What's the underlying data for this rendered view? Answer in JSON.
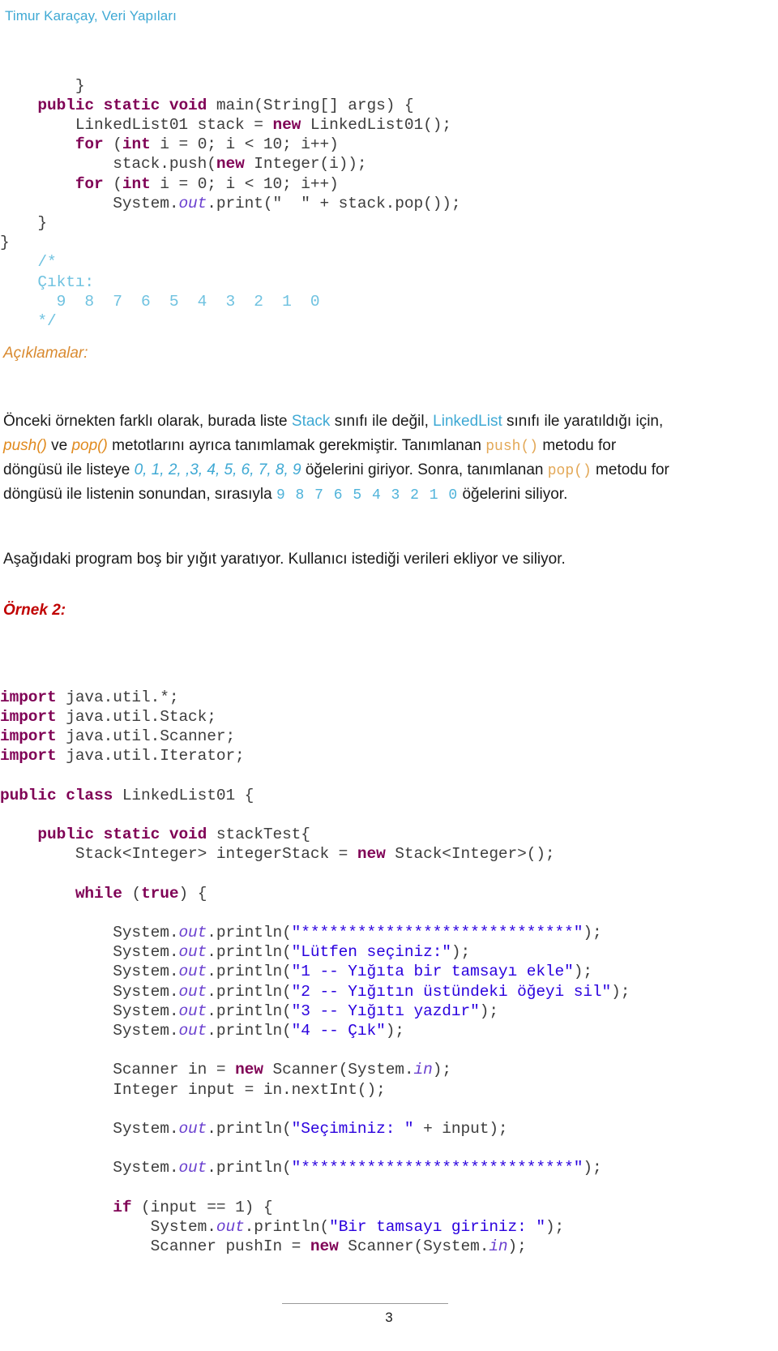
{
  "header": {
    "running_title": "Timur Karaçay, Veri Yapıları",
    "color": "#3FA9D4"
  },
  "code_block_1": {
    "lines": [
      [
        {
          "t": "        }",
          "c": "plain"
        }
      ],
      [
        {
          "t": "    ",
          "c": "plain"
        },
        {
          "t": "public static void ",
          "c": "kw"
        },
        {
          "t": "main(String[] args) {",
          "c": "plain"
        }
      ],
      [
        {
          "t": "        LinkedList01 stack = ",
          "c": "plain"
        },
        {
          "t": "new ",
          "c": "kw"
        },
        {
          "t": "LinkedList01();",
          "c": "plain"
        }
      ],
      [
        {
          "t": "        ",
          "c": "plain"
        },
        {
          "t": "for ",
          "c": "kw"
        },
        {
          "t": "(",
          "c": "plain"
        },
        {
          "t": "int ",
          "c": "kw"
        },
        {
          "t": "i = 0; i < 10; i++)",
          "c": "plain"
        }
      ],
      [
        {
          "t": "            stack.push(",
          "c": "plain"
        },
        {
          "t": "new ",
          "c": "kw"
        },
        {
          "t": "Integer(i));",
          "c": "plain"
        }
      ],
      [
        {
          "t": "        ",
          "c": "plain"
        },
        {
          "t": "for ",
          "c": "kw"
        },
        {
          "t": "(",
          "c": "plain"
        },
        {
          "t": "int ",
          "c": "kw"
        },
        {
          "t": "i = 0; i < 10; i++)",
          "c": "plain"
        }
      ],
      [
        {
          "t": "            System.",
          "c": "plain"
        },
        {
          "t": "out",
          "c": "fld"
        },
        {
          "t": ".print(\"  \" + stack.pop());",
          "c": "plain"
        }
      ],
      [
        {
          "t": "    }",
          "c": "plain"
        }
      ],
      [
        {
          "t": "}",
          "c": "plain"
        }
      ],
      [
        {
          "t": "    ",
          "c": "plain"
        },
        {
          "t": "/*",
          "c": "cmt"
        }
      ],
      [
        {
          "t": "    ",
          "c": "plain"
        },
        {
          "t": "Çıktı:",
          "c": "cmt"
        }
      ],
      [
        {
          "t": "    ",
          "c": "plain"
        },
        {
          "t": "  9  8  7  6  5  4  3  2  1  0",
          "c": "cmt"
        }
      ],
      [
        {
          "t": "    ",
          "c": "plain"
        },
        {
          "t": "*/",
          "c": "cmt"
        }
      ]
    ]
  },
  "explanations": {
    "heading": "Açıklamalar:",
    "paragraph_lines": [
      [
        {
          "t": "Önceki örnekten farklı olarak, burada liste  ",
          "c": "normal"
        },
        {
          "t": "Stack",
          "c": "blue"
        },
        {
          "t": " sınıfı ile değil, ",
          "c": "normal"
        },
        {
          "t": "LinkedList",
          "c": "blue"
        },
        {
          "t": " sınıfı ile yaratıldığı için,",
          "c": "normal"
        }
      ],
      [
        {
          "t": "push()",
          "c": "orange"
        },
        {
          "t": " ve ",
          "c": "normal"
        },
        {
          "t": "pop()",
          "c": "orange"
        },
        {
          "t": " metotlarını ayrıca tanımlamak gerekmiştir. Tanımlanan ",
          "c": "normal"
        },
        {
          "t": "push()",
          "c": "orange-mono"
        },
        {
          "t": " metodu for",
          "c": "normal"
        }
      ],
      [
        {
          "t": "döngüsü ile listeye  ",
          "c": "normal"
        },
        {
          "t": "0, 1, 2, ,3, 4, 5, 6, 7, 8, 9",
          "c": "blue-it"
        },
        {
          "t": " öğelerini giriyor. Sonra, tanımlanan ",
          "c": "normal"
        },
        {
          "t": "pop()",
          "c": "orange-mono"
        },
        {
          "t": " metodu for",
          "c": "normal"
        }
      ],
      [
        {
          "t": "döngüsü ile listenin sonundan, sırasıyla ",
          "c": "normal"
        },
        {
          "t": "9  8  7  6  5  4  3  2  1  0",
          "c": "blue-mono"
        },
        {
          "t": " öğelerini siliyor.",
          "c": "normal"
        }
      ]
    ]
  },
  "intro_2": {
    "text": "Aşağıdaki program boş bir yığıt yaratıyor. Kullanıcı istediği verileri ekliyor ve siliyor."
  },
  "example_2": {
    "heading": "Örnek 2:"
  },
  "code_block_2": {
    "lines": [
      [
        {
          "t": "import ",
          "c": "kw"
        },
        {
          "t": "java.util.*;",
          "c": "plain"
        }
      ],
      [
        {
          "t": "import ",
          "c": "kw"
        },
        {
          "t": "java.util.Stack;",
          "c": "plain"
        }
      ],
      [
        {
          "t": "import ",
          "c": "kw"
        },
        {
          "t": "java.util.Scanner;",
          "c": "plain"
        }
      ],
      [
        {
          "t": "import ",
          "c": "kw"
        },
        {
          "t": "java.util.Iterator;",
          "c": "plain"
        }
      ],
      [
        {
          "t": "",
          "c": "plain"
        }
      ],
      [
        {
          "t": "public class ",
          "c": "kw"
        },
        {
          "t": "LinkedList01 {",
          "c": "plain"
        }
      ],
      [
        {
          "t": "",
          "c": "plain"
        }
      ],
      [
        {
          "t": "    ",
          "c": "plain"
        },
        {
          "t": "public static void ",
          "c": "kw"
        },
        {
          "t": "stackTest{",
          "c": "plain"
        }
      ],
      [
        {
          "t": "        Stack<Integer> integerStack = ",
          "c": "plain"
        },
        {
          "t": "new ",
          "c": "kw"
        },
        {
          "t": "Stack<Integer>();",
          "c": "plain"
        }
      ],
      [
        {
          "t": "",
          "c": "plain"
        }
      ],
      [
        {
          "t": "        ",
          "c": "plain"
        },
        {
          "t": "while ",
          "c": "kw"
        },
        {
          "t": "(",
          "c": "plain"
        },
        {
          "t": "true",
          "c": "kw"
        },
        {
          "t": ") {",
          "c": "plain"
        }
      ],
      [
        {
          "t": "",
          "c": "plain"
        }
      ],
      [
        {
          "t": "            System.",
          "c": "plain"
        },
        {
          "t": "out",
          "c": "fld"
        },
        {
          "t": ".println(",
          "c": "plain"
        },
        {
          "t": "\"*****************************\"",
          "c": "str"
        },
        {
          "t": ");",
          "c": "plain"
        }
      ],
      [
        {
          "t": "            System.",
          "c": "plain"
        },
        {
          "t": "out",
          "c": "fld"
        },
        {
          "t": ".println(",
          "c": "plain"
        },
        {
          "t": "\"Lütfen seçiniz:\"",
          "c": "str"
        },
        {
          "t": ");",
          "c": "plain"
        }
      ],
      [
        {
          "t": "            System.",
          "c": "plain"
        },
        {
          "t": "out",
          "c": "fld"
        },
        {
          "t": ".println(",
          "c": "plain"
        },
        {
          "t": "\"1 -- Yığıta bir tamsayı ekle\"",
          "c": "str"
        },
        {
          "t": ");",
          "c": "plain"
        }
      ],
      [
        {
          "t": "            System.",
          "c": "plain"
        },
        {
          "t": "out",
          "c": "fld"
        },
        {
          "t": ".println(",
          "c": "plain"
        },
        {
          "t": "\"2 -- Yığıtın üstündeki öğeyi sil\"",
          "c": "str"
        },
        {
          "t": ");",
          "c": "plain"
        }
      ],
      [
        {
          "t": "            System.",
          "c": "plain"
        },
        {
          "t": "out",
          "c": "fld"
        },
        {
          "t": ".println(",
          "c": "plain"
        },
        {
          "t": "\"3 -- Yığıtı yazdır\"",
          "c": "str"
        },
        {
          "t": ");",
          "c": "plain"
        }
      ],
      [
        {
          "t": "            System.",
          "c": "plain"
        },
        {
          "t": "out",
          "c": "fld"
        },
        {
          "t": ".println(",
          "c": "plain"
        },
        {
          "t": "\"4 -- Çık\"",
          "c": "str"
        },
        {
          "t": ");",
          "c": "plain"
        }
      ],
      [
        {
          "t": "",
          "c": "plain"
        }
      ],
      [
        {
          "t": "            Scanner in = ",
          "c": "plain"
        },
        {
          "t": "new ",
          "c": "kw"
        },
        {
          "t": "Scanner(System.",
          "c": "plain"
        },
        {
          "t": "in",
          "c": "fld"
        },
        {
          "t": ");",
          "c": "plain"
        }
      ],
      [
        {
          "t": "            Integer input = in.nextInt();",
          "c": "plain"
        }
      ],
      [
        {
          "t": "",
          "c": "plain"
        }
      ],
      [
        {
          "t": "            System.",
          "c": "plain"
        },
        {
          "t": "out",
          "c": "fld"
        },
        {
          "t": ".println(",
          "c": "plain"
        },
        {
          "t": "\"Seçiminiz: \"",
          "c": "str"
        },
        {
          "t": " + input);",
          "c": "plain"
        }
      ],
      [
        {
          "t": "",
          "c": "plain"
        }
      ],
      [
        {
          "t": "            System.",
          "c": "plain"
        },
        {
          "t": "out",
          "c": "fld"
        },
        {
          "t": ".println(",
          "c": "plain"
        },
        {
          "t": "\"*****************************\"",
          "c": "str"
        },
        {
          "t": ");",
          "c": "plain"
        }
      ],
      [
        {
          "t": "",
          "c": "plain"
        }
      ],
      [
        {
          "t": "            ",
          "c": "plain"
        },
        {
          "t": "if ",
          "c": "kw"
        },
        {
          "t": "(input == 1) {",
          "c": "plain"
        }
      ],
      [
        {
          "t": "                System.",
          "c": "plain"
        },
        {
          "t": "out",
          "c": "fld"
        },
        {
          "t": ".println(",
          "c": "plain"
        },
        {
          "t": "\"Bir tamsayı giriniz: \"",
          "c": "str"
        },
        {
          "t": ");",
          "c": "plain"
        }
      ],
      [
        {
          "t": "                Scanner pushIn = ",
          "c": "plain"
        },
        {
          "t": "new ",
          "c": "kw"
        },
        {
          "t": "Scanner(System.",
          "c": "plain"
        },
        {
          "t": "in",
          "c": "fld"
        },
        {
          "t": ");",
          "c": "plain"
        }
      ]
    ]
  },
  "footer": {
    "page_number": "3"
  },
  "colors": {
    "accent_blue": "#3FA9D4",
    "keyword_purple": "#7F0055",
    "string_blue": "#2A00DE",
    "field_violet": "#6A3FCF",
    "comment_cyan": "#6FC2E0",
    "heading_orange": "#D98A30",
    "heading_red": "#C00000"
  }
}
